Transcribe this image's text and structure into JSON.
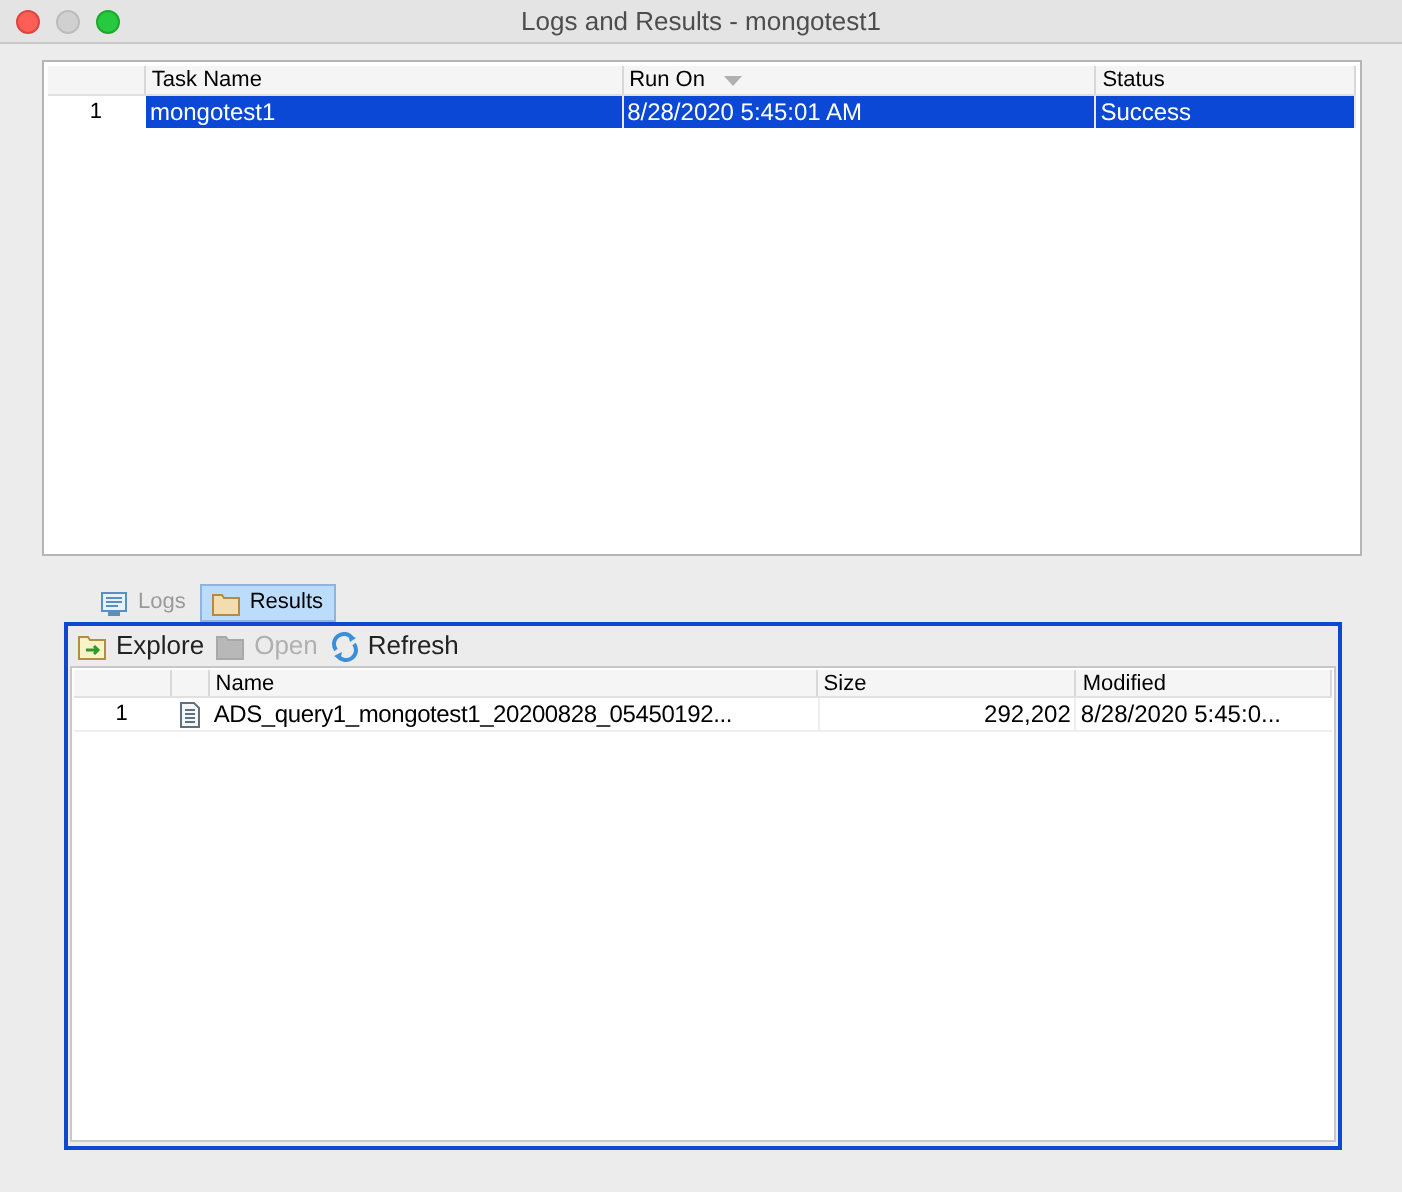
{
  "window": {
    "title": "Logs and Results - mongotest1"
  },
  "tasks_table": {
    "columns": [
      {
        "label": "Task Name",
        "sorted": false
      },
      {
        "label": "Run On",
        "sorted": true
      },
      {
        "label": "Status",
        "sorted": false
      }
    ],
    "rows": [
      {
        "number": "1",
        "cells": [
          "mongotest1",
          "8/28/2020 5:45:01 AM",
          "Success"
        ],
        "selected": true
      }
    ]
  },
  "tabs": [
    {
      "label": "Logs",
      "kind": "logs",
      "selected": false
    },
    {
      "label": "Results",
      "kind": "results",
      "selected": true
    }
  ],
  "toolbar": [
    {
      "label": "Explore",
      "kind": "explore",
      "disabled": false
    },
    {
      "label": "Open",
      "kind": "open",
      "disabled": true
    },
    {
      "label": "Refresh",
      "kind": "refresh",
      "disabled": false
    }
  ],
  "results_table": {
    "columns": [
      "Name",
      "Size",
      "Modified"
    ],
    "rows": [
      {
        "number": "1",
        "name": "ADS_query1_mongotest1_20200828_05450192...",
        "size": "292,202",
        "modified": "8/28/2020 5:45:0..."
      }
    ]
  }
}
